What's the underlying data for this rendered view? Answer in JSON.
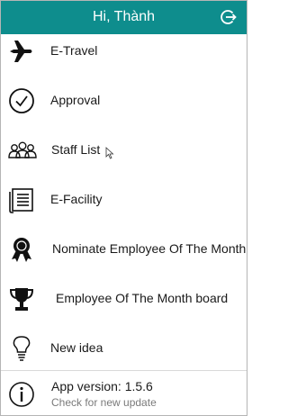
{
  "header": {
    "title": "Hi, Thành"
  },
  "menu": [
    {
      "label": "E-Travel",
      "icon": "airplane-icon"
    },
    {
      "label": "Approval",
      "icon": "checkmark-circle-icon"
    },
    {
      "label": "Staff List",
      "icon": "people-icon"
    },
    {
      "label": "E-Facility",
      "icon": "document-icon"
    },
    {
      "label": "Nominate Employee Of The Month",
      "icon": "award-ribbon-icon"
    },
    {
      "label": "Employee Of The Month board",
      "icon": "trophy-icon"
    },
    {
      "label": "New idea",
      "icon": "lightbulb-icon"
    }
  ],
  "footer": {
    "version": "App version: 1.5.6",
    "update": "Check for new update"
  },
  "colors": {
    "header": "#0e8d8d",
    "text": "#1a1a1a",
    "muted": "#7a7a7a"
  }
}
